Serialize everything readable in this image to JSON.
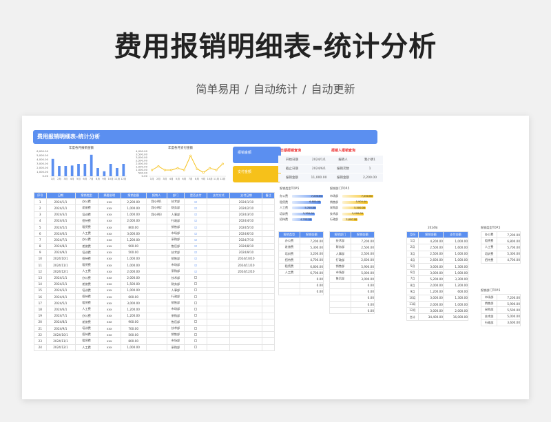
{
  "page": {
    "title": "费用报销明细表-统计分析",
    "subtitle": "简单易用   /   自动统计   /   自动更新"
  },
  "sheet": {
    "header": "费用报销明细表-统计分析",
    "chart_data": [
      {
        "type": "bar",
        "title": "年度各月报销金额",
        "categories": [
          "1月",
          "2月",
          "3月",
          "4月",
          "5月",
          "6月",
          "7月",
          "8月",
          "9月",
          "10月",
          "11月",
          "12月"
        ],
        "values": [
          4200,
          2500,
          2500,
          2600,
          3000,
          3000,
          5200,
          2000,
          1200,
          3000,
          2000,
          3000
        ],
        "ylim": [
          0,
          6000
        ],
        "yticks": [
          "6,000.00",
          "5,000.00",
          "4,000.00",
          "3,000.00",
          "2,000.00",
          "1,000.00",
          "0.00"
        ],
        "color": "#5b8ff0"
      },
      {
        "type": "line",
        "title": "年度各月支付金额",
        "categories": [
          "1月",
          "2月",
          "3月",
          "4月",
          "5月",
          "6月",
          "7月",
          "8月",
          "9月",
          "10月",
          "11月",
          "12月"
        ],
        "values": [
          1000,
          1600,
          1000,
          1000,
          1300,
          1000,
          3300,
          1200,
          600,
          1300,
          1000,
          2000
        ],
        "ylim": [
          0,
          4000
        ],
        "yticks": [
          "4,000.00",
          "3,500.00",
          "3,000.00",
          "2,500.00",
          "2,000.00",
          "1,500.00",
          "1,000.00",
          "500.00",
          "0.00"
        ],
        "color": "#f6c11a"
      }
    ],
    "buttons": {
      "b1": "报销金额",
      "b2": "支付金额"
    },
    "date_query": {
      "title": "日期报销查询",
      "rows": [
        [
          "开始日期",
          "2024/1/1"
        ],
        [
          "截止日期",
          "2024/6/1"
        ],
        [
          "报销金额",
          "11,000.00"
        ]
      ]
    },
    "person_query": {
      "title": "报销人报销查询",
      "rows": [
        [
          "报销人",
          "我小明1"
        ],
        [
          "报销次数",
          "1"
        ],
        [
          "报销金额",
          "2,200.00"
        ]
      ]
    },
    "type_top5": {
      "title": "报销类型TOP.5",
      "items": [
        [
          "办公费",
          "7,200.00",
          72
        ],
        [
          "租赁费",
          "6,800.00",
          68
        ],
        [
          "人工费",
          "5,700.00",
          57
        ],
        [
          "培训费",
          "5,300.00",
          53
        ],
        [
          "招待费",
          "4,700.00",
          47
        ]
      ],
      "color": "#5b8ff0"
    },
    "dept_top5": {
      "title": "报销部门TOP.5",
      "items": [
        [
          "市场部",
          "7,200.00",
          72
        ],
        [
          "销售部",
          "5,900.00",
          59
        ],
        [
          "采购部",
          "5,500.00",
          55
        ],
        [
          "技术部",
          "5,000.00",
          50
        ],
        [
          "行政部",
          "3,600.00",
          36
        ]
      ],
      "color": "#f6c11a"
    },
    "main_table": {
      "headers": [
        "序号",
        "日期",
        "报销类型",
        "摘要说明",
        "报销金额",
        "报销人",
        "部门",
        "是否支付",
        "支付方式",
        "支付日期",
        "备注"
      ],
      "rows": [
        [
          "1",
          "2024/1/1",
          "办公费",
          "xxx",
          "2,200.00",
          "我小明1",
          "技术部",
          "y",
          "",
          "2024/1/10",
          ""
        ],
        [
          "2",
          "2024/2/1",
          "差旅费",
          "xxx",
          "1,000.00",
          "我小明2",
          "财务部",
          "y",
          "",
          "2024/2/10",
          ""
        ],
        [
          "3",
          "2024/3/1",
          "培训费",
          "xxx",
          "1,000.00",
          "我小明3",
          "人事部",
          "y",
          "",
          "2024/3/10",
          ""
        ],
        [
          "4",
          "2024/4/1",
          "招待费",
          "xxx",
          "2,000.00",
          "",
          "行政部",
          "y",
          "",
          "2024/4/10",
          ""
        ],
        [
          "5",
          "2024/5/1",
          "租赁费",
          "xxx",
          "800.00",
          "",
          "销售部",
          "y",
          "",
          "2024/5/10",
          ""
        ],
        [
          "6",
          "2024/6/1",
          "人工费",
          "xxx",
          "3,000.00",
          "",
          "市场部",
          "y",
          "",
          "2024/6/10",
          ""
        ],
        [
          "7",
          "2024/7/1",
          "办公费",
          "xxx",
          "1,200.00",
          "",
          "采购部",
          "y",
          "",
          "2024/7/10",
          ""
        ],
        [
          "8",
          "2024/8/1",
          "差旅费",
          "xxx",
          "900.00",
          "",
          "售后部",
          "y",
          "",
          "2024/8/10",
          ""
        ],
        [
          "9",
          "2024/9/1",
          "培训费",
          "xxx",
          "500.00",
          "",
          "技术部",
          "y",
          "",
          "2024/9/10",
          ""
        ],
        [
          "10",
          "2024/10/1",
          "招待费",
          "xxx",
          "1,000.00",
          "",
          "销售部",
          "y",
          "",
          "2024/10/10",
          ""
        ],
        [
          "11",
          "2024/11/1",
          "租赁费",
          "xxx",
          "1,000.00",
          "",
          "市场部",
          "y",
          "",
          "2024/11/10",
          ""
        ],
        [
          "12",
          "2024/12/1",
          "人工费",
          "xxx",
          "2,000.00",
          "",
          "采购部",
          "y",
          "",
          "2024/12/10",
          ""
        ],
        [
          "13",
          "2024/1/1",
          "办公费",
          "xxx",
          "2,000.00",
          "",
          "技术部",
          "n",
          "",
          "",
          ""
        ],
        [
          "14",
          "2024/2/1",
          "差旅费",
          "xxx",
          "1,500.00",
          "",
          "财务部",
          "n",
          "",
          "",
          ""
        ],
        [
          "15",
          "2024/3/1",
          "培训费",
          "xxx",
          "1,000.00",
          "",
          "人事部",
          "n",
          "",
          "",
          ""
        ],
        [
          "16",
          "2024/4/1",
          "招待费",
          "xxx",
          "600.00",
          "",
          "行政部",
          "n",
          "",
          "",
          ""
        ],
        [
          "17",
          "2024/5/1",
          "租赁费",
          "xxx",
          "3,000.00",
          "",
          "销售部",
          "n",
          "",
          "",
          ""
        ],
        [
          "18",
          "2024/6/1",
          "人工费",
          "xxx",
          "1,200.00",
          "",
          "市场部",
          "n",
          "",
          "",
          ""
        ],
        [
          "19",
          "2024/7/1",
          "办公费",
          "xxx",
          "1,200.00",
          "",
          "采购部",
          "n",
          "",
          "",
          ""
        ],
        [
          "20",
          "2024/8/1",
          "差旅费",
          "xxx",
          "900.00",
          "",
          "售后部",
          "n",
          "",
          "",
          ""
        ],
        [
          "21",
          "2024/9/1",
          "培训费",
          "xxx",
          "700.00",
          "",
          "技术部",
          "n",
          "",
          "",
          ""
        ],
        [
          "22",
          "2024/10/1",
          "招待费",
          "xxx",
          "500.00",
          "",
          "销售部",
          "n",
          "",
          "",
          ""
        ],
        [
          "23",
          "2024/11/1",
          "租赁费",
          "xxx",
          "800.00",
          "",
          "市场部",
          "n",
          "",
          "",
          ""
        ],
        [
          "24",
          "2024/12/1",
          "人工费",
          "xxx",
          "1,000.00",
          "",
          "采购部",
          "n",
          "",
          "",
          ""
        ]
      ]
    },
    "type_summary": {
      "headers": [
        "报销类型",
        "报销金额"
      ],
      "rows": [
        [
          "办公费",
          "7,200.00"
        ],
        [
          "差旅费",
          "5,300.00"
        ],
        [
          "培训费",
          "3,200.00"
        ],
        [
          "招待费",
          "4,700.00"
        ],
        [
          "租赁费",
          "6,800.00"
        ],
        [
          "人工费",
          "6,700.00"
        ],
        [
          "",
          "0.00"
        ],
        [
          "",
          "0.00"
        ],
        [
          "",
          "0.00"
        ]
      ]
    },
    "dept_summary": {
      "headers": [
        "报销部门",
        "报销金额"
      ],
      "rows": [
        [
          "技术部",
          "7,200.00"
        ],
        [
          "财务部",
          "2,500.00"
        ],
        [
          "人事部",
          "2,500.00"
        ],
        [
          "行政部",
          "2,600.00"
        ],
        [
          "销售部",
          "5,900.00"
        ],
        [
          "市场部",
          "5,000.00"
        ],
        [
          "售后部",
          "3,000.00"
        ],
        [
          "",
          "0.00"
        ],
        [
          "",
          "0.00"
        ],
        [
          "",
          "0.00"
        ],
        [
          "",
          "0.00"
        ],
        [
          "",
          "0.00"
        ]
      ]
    },
    "month_summary": {
      "caption": "2024年",
      "headers": [
        "月份",
        "报销金额",
        "支付金额"
      ],
      "rows": [
        [
          "1月",
          "4,200.00",
          "1,000.00"
        ],
        [
          "2月",
          "2,500.00",
          "1,600.00"
        ],
        [
          "3月",
          "2,500.00",
          "1,000.00"
        ],
        [
          "4月",
          "2,600.00",
          "1,000.00"
        ],
        [
          "5月",
          "3,000.00",
          "1,300.00"
        ],
        [
          "6月",
          "3,000.00",
          "1,000.00"
        ],
        [
          "7月",
          "5,200.00",
          "3,300.00"
        ],
        [
          "8月",
          "2,000.00",
          "1,200.00"
        ],
        [
          "9月",
          "1,200.00",
          "600.00"
        ],
        [
          "10月",
          "3,000.00",
          "1,300.00"
        ],
        [
          "11月",
          "2,000.00",
          "1,000.00"
        ],
        [
          "12月",
          "3,000.00",
          "2,000.00"
        ],
        [
          "合计",
          "34,400.00",
          "16,000.00"
        ]
      ]
    },
    "type_top5_table": {
      "caption": "报销类型TOP.5",
      "rows": [
        [
          "办公费",
          "7,200.00"
        ],
        [
          "租赁费",
          "6,800.00"
        ],
        [
          "人工费",
          "5,700.00"
        ],
        [
          "培训费",
          "5,300.00"
        ],
        [
          "招待费",
          "4,700.00"
        ]
      ]
    },
    "dept_top5_table": {
      "caption": "报销部门TOP.5",
      "rows": [
        [
          "市场部",
          "7,200.00"
        ],
        [
          "销售部",
          "5,900.00"
        ],
        [
          "采购部",
          "5,500.00"
        ],
        [
          "技术部",
          "5,000.00"
        ],
        [
          "行政部",
          "3,600.00"
        ]
      ]
    }
  }
}
